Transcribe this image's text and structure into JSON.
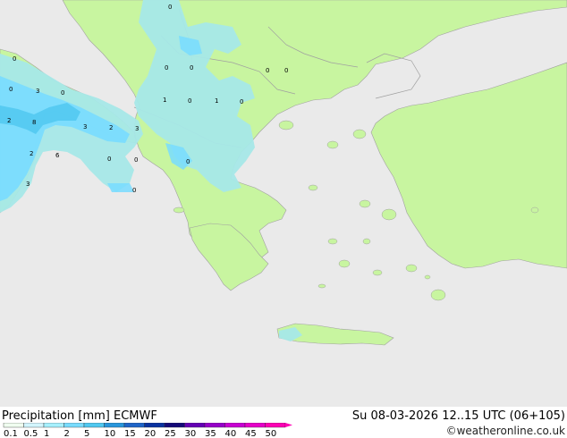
{
  "map": {
    "labels": [
      "0",
      "0",
      "0",
      "0",
      "0",
      "0",
      "3",
      "0",
      "2",
      "8",
      "3",
      "2",
      "3",
      "2",
      "6",
      "0",
      "0",
      "3",
      "0",
      "0",
      "1",
      "0",
      "1",
      "0",
      "0"
    ]
  },
  "footer": {
    "title": "Precipitation [mm]  ECMWF",
    "datetime": "Su 08-03-2026 12..15 UTC (06+105)",
    "credit": "©weatheronline.co.uk"
  },
  "legend": {
    "ticks": [
      "0.1",
      "0.5",
      "1",
      "2",
      "5",
      "10",
      "15",
      "20",
      "25",
      "30",
      "35",
      "40",
      "45",
      "50"
    ],
    "colors": [
      "#f0fff0",
      "#d2f5ff",
      "#a6f0ff",
      "#78dcff",
      "#50c8f0",
      "#2896dc",
      "#1e64c8",
      "#0a32a0",
      "#140a78",
      "#6400b4",
      "#9600c8",
      "#c800d2",
      "#e600c8",
      "#ff00b4"
    ]
  },
  "colors": {
    "sea": "#eaeaea",
    "land": "#c8f5a0",
    "border": "#a0a0a0",
    "precip_light": "#a6e8e8",
    "precip_mid": "#78dcff",
    "precip_heavy": "#50c8f0"
  }
}
